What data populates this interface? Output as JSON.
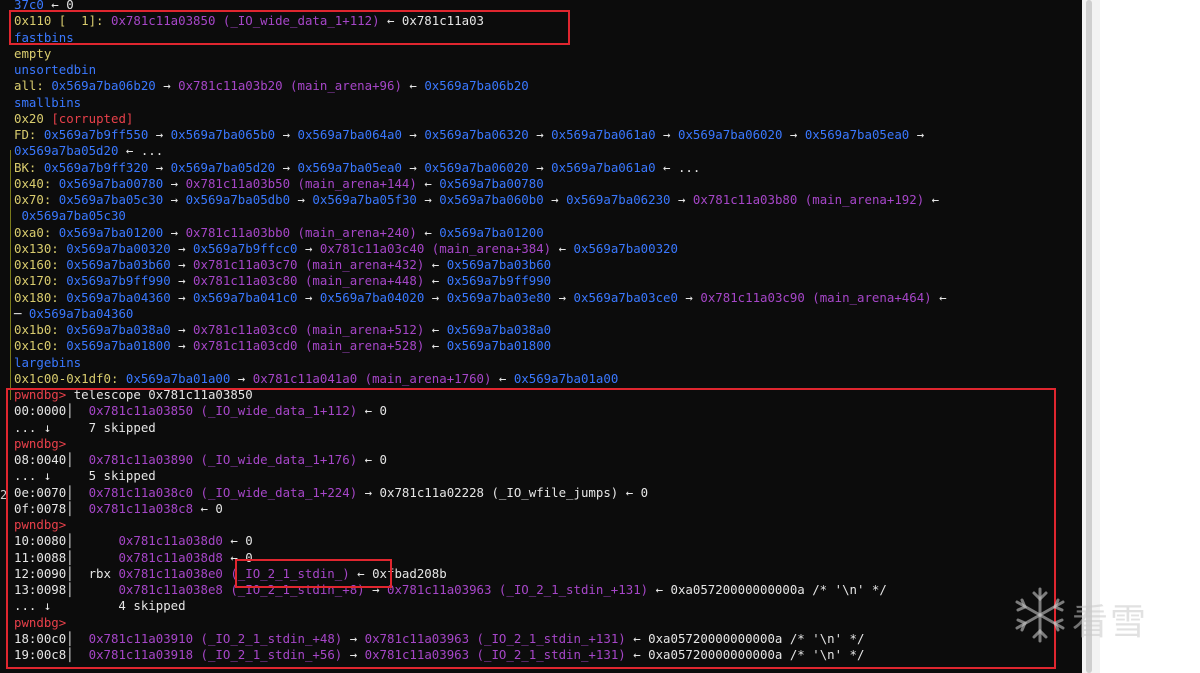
{
  "terminal": {
    "lines": [
      {
        "segments": [
          {
            "t": "37c0",
            "c": "blue"
          },
          {
            "t": " ← 0",
            "c": "white"
          }
        ]
      },
      {
        "segments": [
          {
            "t": "0x110 [  1]: ",
            "c": "yellow"
          },
          {
            "t": "0x781c11a03850 (_IO_wide_data_1+112)",
            "c": "purple"
          },
          {
            "t": " ← 0x781c11a03",
            "c": "white"
          }
        ]
      },
      {
        "segments": [
          {
            "t": "fastbins",
            "c": "blue"
          }
        ]
      },
      {
        "segments": [
          {
            "t": "empty",
            "c": "yellow"
          }
        ]
      },
      {
        "segments": [
          {
            "t": "unsortedbin",
            "c": "blue"
          }
        ]
      },
      {
        "segments": [
          {
            "t": "all: ",
            "c": "yellow"
          },
          {
            "t": "0x569a7ba06b20",
            "c": "blue"
          },
          {
            "t": " → ",
            "c": "white"
          },
          {
            "t": "0x781c11a03b20 (main_arena+96)",
            "c": "purple"
          },
          {
            "t": " ← ",
            "c": "white"
          },
          {
            "t": "0x569a7ba06b20",
            "c": "blue"
          }
        ]
      },
      {
        "segments": [
          {
            "t": "smallbins",
            "c": "blue"
          }
        ]
      },
      {
        "segments": [
          {
            "t": "0x20 ",
            "c": "yellow"
          },
          {
            "t": "[corrupted]",
            "c": "red"
          }
        ]
      },
      {
        "segments": [
          {
            "t": "FD: ",
            "c": "yellow"
          },
          {
            "t": "0x569a7b9ff550",
            "c": "blue"
          },
          {
            "t": " → ",
            "c": "white"
          },
          {
            "t": "0x569a7ba065b0",
            "c": "blue"
          },
          {
            "t": " → ",
            "c": "white"
          },
          {
            "t": "0x569a7ba064a0",
            "c": "blue"
          },
          {
            "t": " → ",
            "c": "white"
          },
          {
            "t": "0x569a7ba06320",
            "c": "blue"
          },
          {
            "t": " → ",
            "c": "white"
          },
          {
            "t": "0x569a7ba061a0",
            "c": "blue"
          },
          {
            "t": " → ",
            "c": "white"
          },
          {
            "t": "0x569a7ba06020",
            "c": "blue"
          },
          {
            "t": " → ",
            "c": "white"
          },
          {
            "t": "0x569a7ba05ea0",
            "c": "blue"
          },
          {
            "t": " →",
            "c": "white"
          }
        ]
      },
      {
        "segments": [
          {
            "t": "0x569a7ba05d20",
            "c": "blue"
          },
          {
            "t": " ← ...",
            "c": "white"
          }
        ]
      },
      {
        "segments": [
          {
            "t": "BK: ",
            "c": "yellow"
          },
          {
            "t": "0x569a7b9ff320",
            "c": "blue"
          },
          {
            "t": " → ",
            "c": "white"
          },
          {
            "t": "0x569a7ba05d20",
            "c": "blue"
          },
          {
            "t": " → ",
            "c": "white"
          },
          {
            "t": "0x569a7ba05ea0",
            "c": "blue"
          },
          {
            "t": " → ",
            "c": "white"
          },
          {
            "t": "0x569a7ba06020",
            "c": "blue"
          },
          {
            "t": " → ",
            "c": "white"
          },
          {
            "t": "0x569a7ba061a0",
            "c": "blue"
          },
          {
            "t": " ← ...",
            "c": "white"
          }
        ]
      },
      {
        "segments": [
          {
            "t": "0x40: ",
            "c": "yellow"
          },
          {
            "t": "0x569a7ba00780",
            "c": "blue"
          },
          {
            "t": " → ",
            "c": "white"
          },
          {
            "t": "0x781c11a03b50 (main_arena+144)",
            "c": "purple"
          },
          {
            "t": " ← ",
            "c": "white"
          },
          {
            "t": "0x569a7ba00780",
            "c": "blue"
          }
        ]
      },
      {
        "segments": [
          {
            "t": "0x70: ",
            "c": "yellow"
          },
          {
            "t": "0x569a7ba05c30",
            "c": "blue"
          },
          {
            "t": " → ",
            "c": "white"
          },
          {
            "t": "0x569a7ba05db0",
            "c": "blue"
          },
          {
            "t": " → ",
            "c": "white"
          },
          {
            "t": "0x569a7ba05f30",
            "c": "blue"
          },
          {
            "t": " → ",
            "c": "white"
          },
          {
            "t": "0x569a7ba060b0",
            "c": "blue"
          },
          {
            "t": " → ",
            "c": "white"
          },
          {
            "t": "0x569a7ba06230",
            "c": "blue"
          },
          {
            "t": " → ",
            "c": "white"
          },
          {
            "t": "0x781c11a03b80 (main_arena+192)",
            "c": "purple"
          },
          {
            "t": " ←",
            "c": "white"
          }
        ]
      },
      {
        "segments": [
          {
            "t": " 0x569a7ba05c30",
            "c": "blue"
          }
        ]
      },
      {
        "segments": [
          {
            "t": "0xa0: ",
            "c": "yellow"
          },
          {
            "t": "0x569a7ba01200",
            "c": "blue"
          },
          {
            "t": " → ",
            "c": "white"
          },
          {
            "t": "0x781c11a03bb0 (main_arena+240)",
            "c": "purple"
          },
          {
            "t": " ← ",
            "c": "white"
          },
          {
            "t": "0x569a7ba01200",
            "c": "blue"
          }
        ]
      },
      {
        "segments": [
          {
            "t": "0x130: ",
            "c": "yellow"
          },
          {
            "t": "0x569a7ba00320",
            "c": "blue"
          },
          {
            "t": " → ",
            "c": "white"
          },
          {
            "t": "0x569a7b9ffcc0",
            "c": "blue"
          },
          {
            "t": " → ",
            "c": "white"
          },
          {
            "t": "0x781c11a03c40 (main_arena+384)",
            "c": "purple"
          },
          {
            "t": " ← ",
            "c": "white"
          },
          {
            "t": "0x569a7ba00320",
            "c": "blue"
          }
        ]
      },
      {
        "segments": [
          {
            "t": "0x160: ",
            "c": "yellow"
          },
          {
            "t": "0x569a7ba03b60",
            "c": "blue"
          },
          {
            "t": " → ",
            "c": "white"
          },
          {
            "t": "0x781c11a03c70 (main_arena+432)",
            "c": "purple"
          },
          {
            "t": " ← ",
            "c": "white"
          },
          {
            "t": "0x569a7ba03b60",
            "c": "blue"
          }
        ]
      },
      {
        "segments": [
          {
            "t": "0x170: ",
            "c": "yellow"
          },
          {
            "t": "0x569a7b9ff990",
            "c": "blue"
          },
          {
            "t": " → ",
            "c": "white"
          },
          {
            "t": "0x781c11a03c80 (main_arena+448)",
            "c": "purple"
          },
          {
            "t": " ← ",
            "c": "white"
          },
          {
            "t": "0x569a7b9ff990",
            "c": "blue"
          }
        ]
      },
      {
        "segments": [
          {
            "t": "0x180: ",
            "c": "yellow"
          },
          {
            "t": "0x569a7ba04360",
            "c": "blue"
          },
          {
            "t": " → ",
            "c": "white"
          },
          {
            "t": "0x569a7ba041c0",
            "c": "blue"
          },
          {
            "t": " → ",
            "c": "white"
          },
          {
            "t": "0x569a7ba04020",
            "c": "blue"
          },
          {
            "t": " → ",
            "c": "white"
          },
          {
            "t": "0x569a7ba03e80",
            "c": "blue"
          },
          {
            "t": " → ",
            "c": "white"
          },
          {
            "t": "0x569a7ba03ce0",
            "c": "blue"
          },
          {
            "t": " → ",
            "c": "white"
          },
          {
            "t": "0x781c11a03c90 (main_arena+464)",
            "c": "purple"
          },
          {
            "t": " ←",
            "c": "white"
          }
        ]
      },
      {
        "segments": [
          {
            "t": "─ ",
            "c": "white"
          },
          {
            "t": "0x569a7ba04360",
            "c": "blue"
          }
        ]
      },
      {
        "segments": [
          {
            "t": "0x1b0: ",
            "c": "yellow"
          },
          {
            "t": "0x569a7ba038a0",
            "c": "blue"
          },
          {
            "t": " → ",
            "c": "white"
          },
          {
            "t": "0x781c11a03cc0 (main_arena+512)",
            "c": "purple"
          },
          {
            "t": " ← ",
            "c": "white"
          },
          {
            "t": "0x569a7ba038a0",
            "c": "blue"
          }
        ]
      },
      {
        "segments": [
          {
            "t": "0x1c0: ",
            "c": "yellow"
          },
          {
            "t": "0x569a7ba01800",
            "c": "blue"
          },
          {
            "t": " → ",
            "c": "white"
          },
          {
            "t": "0x781c11a03cd0 (main_arena+528)",
            "c": "purple"
          },
          {
            "t": " ← ",
            "c": "white"
          },
          {
            "t": "0x569a7ba01800",
            "c": "blue"
          }
        ]
      },
      {
        "segments": [
          {
            "t": "largebins",
            "c": "blue"
          }
        ]
      },
      {
        "segments": [
          {
            "t": "0x1c00-0x1df0: ",
            "c": "yellow"
          },
          {
            "t": "0x569a7ba01a00",
            "c": "blue"
          },
          {
            "t": " → ",
            "c": "white"
          },
          {
            "t": "0x781c11a041a0 (main_arena+1760)",
            "c": "purple"
          },
          {
            "t": " ← ",
            "c": "white"
          },
          {
            "t": "0x569a7ba01a00",
            "c": "blue"
          }
        ]
      },
      {
        "segments": [
          {
            "t": "pwndbg> ",
            "c": "red"
          },
          {
            "t": "telescope 0x781c11a03850",
            "c": "white"
          }
        ]
      },
      {
        "segments": [
          {
            "t": "00:0000│  ",
            "c": "white"
          },
          {
            "t": "0x781c11a03850 (_IO_wide_data_1+112)",
            "c": "purple"
          },
          {
            "t": " ← 0",
            "c": "white"
          }
        ]
      },
      {
        "segments": [
          {
            "t": "... ↓     7 skipped",
            "c": "white"
          }
        ]
      },
      {
        "segments": [
          {
            "t": "pwndbg>",
            "c": "red"
          }
        ]
      },
      {
        "segments": [
          {
            "t": "08:0040│  ",
            "c": "white"
          },
          {
            "t": "0x781c11a03890 (_IO_wide_data_1+176)",
            "c": "purple"
          },
          {
            "t": " ← 0",
            "c": "white"
          }
        ]
      },
      {
        "segments": [
          {
            "t": "... ↓     5 skipped",
            "c": "white"
          }
        ]
      },
      {
        "segments": [
          {
            "t": "0e:0070│  ",
            "c": "white"
          },
          {
            "t": "0x781c11a038c0 (_IO_wide_data_1+224)",
            "c": "purple"
          },
          {
            "t": " → 0x781c11a02228 (_IO_wfile_jumps) ← 0",
            "c": "white"
          }
        ]
      },
      {
        "segments": [
          {
            "t": "0f:0078│  ",
            "c": "white"
          },
          {
            "t": "0x781c11a038c8",
            "c": "purple"
          },
          {
            "t": " ← 0",
            "c": "white"
          }
        ]
      },
      {
        "segments": [
          {
            "t": "pwndbg>",
            "c": "red"
          }
        ]
      },
      {
        "segments": [
          {
            "t": "10:0080│      ",
            "c": "white"
          },
          {
            "t": "0x781c11a038d0",
            "c": "purple"
          },
          {
            "t": " ← 0",
            "c": "white"
          }
        ]
      },
      {
        "segments": [
          {
            "t": "11:0088│      ",
            "c": "white"
          },
          {
            "t": "0x781c11a038d8",
            "c": "purple"
          },
          {
            "t": " ← 0",
            "c": "white"
          }
        ]
      },
      {
        "segments": [
          {
            "t": "12:0090│  rbx ",
            "c": "white"
          },
          {
            "t": "0x781c11a038e0 (_IO_2_1_stdin_)",
            "c": "purple"
          },
          {
            "t": " ← 0xfbad208b",
            "c": "white"
          }
        ]
      },
      {
        "segments": [
          {
            "t": "13:0098│      ",
            "c": "white"
          },
          {
            "t": "0x781c11a038e8 (_IO_2_1_stdin_+8)",
            "c": "purple"
          },
          {
            "t": " → ",
            "c": "white"
          },
          {
            "t": "0x781c11a03963 (_IO_2_1_stdin_+131)",
            "c": "purple"
          },
          {
            "t": " ← 0xa05720000000000a /* '\\n' */",
            "c": "white"
          }
        ]
      },
      {
        "segments": [
          {
            "t": "... ↓         4 skipped",
            "c": "white"
          }
        ]
      },
      {
        "segments": [
          {
            "t": "pwndbg>",
            "c": "red"
          }
        ]
      },
      {
        "segments": [
          {
            "t": "18:00c0│  ",
            "c": "white"
          },
          {
            "t": "0x781c11a03910 (_IO_2_1_stdin_+48)",
            "c": "purple"
          },
          {
            "t": " → ",
            "c": "white"
          },
          {
            "t": "0x781c11a03963 (_IO_2_1_stdin_+131)",
            "c": "purple"
          },
          {
            "t": " ← 0xa05720000000000a /* '\\n' */",
            "c": "white"
          }
        ]
      },
      {
        "segments": [
          {
            "t": "19:00c8│  ",
            "c": "white"
          },
          {
            "t": "0x781c11a03918 (_IO_2_1_stdin_+56)",
            "c": "purple"
          },
          {
            "t": " → ",
            "c": "white"
          },
          {
            "t": "0x781c11a03963 (_IO_2_1_stdin_+131)",
            "c": "purple"
          },
          {
            "t": " ← 0xa05720000000000a /* '\\n' */",
            "c": "white"
          }
        ]
      }
    ],
    "gutter_marks": [
      "2"
    ]
  },
  "watermark": {
    "text": "看雪",
    "icon": "snowflake-icon"
  },
  "colors": {
    "background": "#0c0c0c",
    "white": "#e6e6e6",
    "yellow": "#d9cc6e",
    "blue": "#3a78ff",
    "purple": "#a646c8",
    "red": "#e8404a",
    "highlight_box": "#e0262f"
  }
}
